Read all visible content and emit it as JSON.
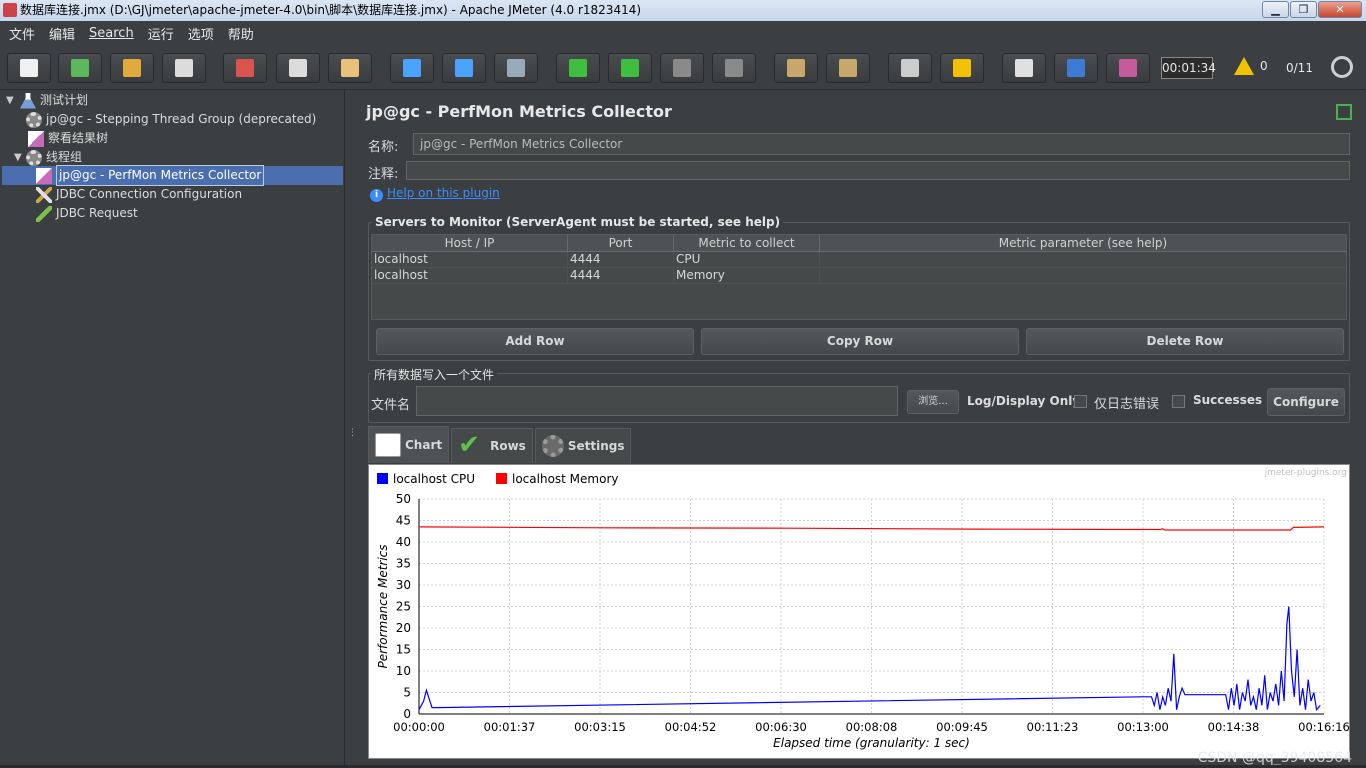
{
  "window": {
    "title": "数据库连接.jmx (D:\\GJ\\jmeter\\apache-jmeter-4.0\\bin\\脚本\\数据库连接.jmx) - Apache JMeter (4.0 r1823414)",
    "min": "▁",
    "max": "❐",
    "close": "✕"
  },
  "menu": [
    "文件",
    "编辑",
    "Search",
    "运行",
    "选项",
    "帮助"
  ],
  "toolbar": {
    "timer": "00:01:34",
    "warnings": "0",
    "threads": "0/11",
    "buttons": [
      {
        "name": "new-icon",
        "color": "#f0f0f0"
      },
      {
        "name": "templates-icon",
        "color": "#5cb85c"
      },
      {
        "name": "open-icon",
        "color": "#e2a93b"
      },
      {
        "name": "save-icon",
        "color": "#dcdcdc"
      },
      {
        "name": "cut-icon",
        "color": "#d9534f"
      },
      {
        "name": "copy-icon",
        "color": "#dcdcdc"
      },
      {
        "name": "paste-icon",
        "color": "#e8c27a"
      },
      {
        "name": "expand-icon",
        "color": "#4aa3ff"
      },
      {
        "name": "collapse-icon",
        "color": "#4aa3ff"
      },
      {
        "name": "toggle-icon",
        "color": "#9ab"
      },
      {
        "name": "start-icon",
        "color": "#3fbf3f"
      },
      {
        "name": "start-no-pause-icon",
        "color": "#3fbf3f"
      },
      {
        "name": "stop-icon",
        "color": "#8a8a8a"
      },
      {
        "name": "shutdown-icon",
        "color": "#8a8a8a"
      },
      {
        "name": "clear-icon",
        "color": "#c8a86a"
      },
      {
        "name": "clear-all-icon",
        "color": "#c8a86a"
      },
      {
        "name": "search-icon",
        "color": "#cccccc"
      },
      {
        "name": "reset-search-icon",
        "color": "#f2c200"
      },
      {
        "name": "function-helper-icon",
        "color": "#e0e0e0"
      },
      {
        "name": "help-icon",
        "color": "#3b7bd6"
      },
      {
        "name": "remote-icon",
        "color": "#c75a9b"
      }
    ]
  },
  "tree": [
    {
      "label": "测试计划",
      "icon": "flask-icon"
    },
    {
      "label": "jp@gc - Stepping Thread Group (deprecated)",
      "icon": "gear-icon"
    },
    {
      "label": "察看结果树",
      "icon": "chart-icon"
    },
    {
      "label": "线程组",
      "icon": "gear-icon"
    },
    {
      "label": "jp@gc - PerfMon Metrics Collector",
      "icon": "chart-icon"
    },
    {
      "label": "JDBC Connection Configuration",
      "icon": "wrench-icon"
    },
    {
      "label": "JDBC Request",
      "icon": "pen-icon"
    }
  ],
  "panel": {
    "title": "jp@gc - PerfMon Metrics Collector",
    "name_label": "名称:",
    "name_value": "jp@gc - PerfMon Metrics Collector",
    "comment_label": "注释:",
    "comment_value": "",
    "help_link": "Help on this plugin"
  },
  "servers": {
    "group_title": "Servers to Monitor (ServerAgent must be started, see help)",
    "columns": [
      "Host / IP",
      "Port",
      "Metric to collect",
      "Metric parameter (see help)"
    ],
    "rows": [
      [
        "localhost",
        "4444",
        "CPU",
        ""
      ],
      [
        "localhost",
        "4444",
        "Memory",
        ""
      ]
    ],
    "add_row": "Add Row",
    "copy_row": "Copy Row",
    "delete_row": "Delete Row"
  },
  "file": {
    "group_title": "所有数据写入一个文件",
    "filename_label": "文件名",
    "filename_value": "",
    "browse": "浏览...",
    "log_display_label": "Log/Display Only:",
    "errors_label": "仅日志错误",
    "successes_label": "Successes",
    "configure": "Configure"
  },
  "tabs": [
    {
      "label": "Chart",
      "icon": "chart-tab-icon",
      "active": true
    },
    {
      "label": "Rows",
      "icon": "check-icon",
      "active": false
    },
    {
      "label": "Settings",
      "icon": "gear-icon",
      "active": false
    }
  ],
  "chart_data": {
    "type": "line",
    "watermark": "jmeter-plugins.org",
    "xlabel": "Elapsed time (granularity: 1 sec)",
    "ylabel": "Performance Metrics",
    "ylim": [
      0,
      50
    ],
    "yticks": [
      "0",
      "5",
      "10",
      "15",
      "20",
      "25",
      "30",
      "35",
      "40",
      "45",
      "50"
    ],
    "xticks": [
      "00:00:00",
      "00:01:37",
      "00:03:15",
      "00:04:52",
      "00:06:30",
      "00:08:08",
      "00:09:45",
      "00:11:23",
      "00:13:00",
      "00:14:38",
      "00:16:16"
    ],
    "xlim_sec": [
      0,
      976
    ],
    "grid": true,
    "legend_position": "top-left",
    "series": [
      {
        "name": "localhost CPU",
        "color": "#0000ff",
        "points": [
          [
            0,
            1
          ],
          [
            5,
            3
          ],
          [
            8,
            5.5
          ],
          [
            11,
            3.5
          ],
          [
            14,
            1.5
          ],
          [
            20,
            1.5
          ],
          [
            780,
            4
          ],
          [
            790,
            4
          ],
          [
            793,
            2
          ],
          [
            796,
            5
          ],
          [
            799,
            1
          ],
          [
            802,
            4
          ],
          [
            805,
            2
          ],
          [
            808,
            6
          ],
          [
            811,
            3
          ],
          [
            814,
            14
          ],
          [
            817,
            1
          ],
          [
            820,
            4
          ],
          [
            823,
            6
          ],
          [
            826,
            4.5
          ],
          [
            870,
            4.5
          ],
          [
            873,
            1
          ],
          [
            876,
            6
          ],
          [
            879,
            2
          ],
          [
            882,
            7
          ],
          [
            885,
            1
          ],
          [
            888,
            5
          ],
          [
            891,
            3
          ],
          [
            894,
            8
          ],
          [
            897,
            2
          ],
          [
            900,
            4
          ],
          [
            903,
            1
          ],
          [
            906,
            6
          ],
          [
            909,
            2
          ],
          [
            912,
            9
          ],
          [
            915,
            1
          ],
          [
            918,
            5
          ],
          [
            921,
            3
          ],
          [
            924,
            7
          ],
          [
            927,
            2
          ],
          [
            930,
            10
          ],
          [
            933,
            3
          ],
          [
            936,
            21
          ],
          [
            938,
            25
          ],
          [
            941,
            10
          ],
          [
            944,
            4
          ],
          [
            947,
            15
          ],
          [
            950,
            2
          ],
          [
            953,
            6
          ],
          [
            956,
            1
          ],
          [
            959,
            8
          ],
          [
            962,
            3
          ],
          [
            965,
            5
          ],
          [
            968,
            1
          ],
          [
            972,
            2
          ]
        ]
      },
      {
        "name": "localhost Memory",
        "color": "#ff0000",
        "points": [
          [
            0,
            43.5
          ],
          [
            200,
            43.3
          ],
          [
            400,
            43.2
          ],
          [
            600,
            43
          ],
          [
            800,
            42.9
          ],
          [
            802,
            43.1
          ],
          [
            804,
            42.8
          ],
          [
            900,
            42.8
          ],
          [
            940,
            42.8
          ],
          [
            943,
            43.4
          ],
          [
            976,
            43.5
          ]
        ]
      }
    ]
  },
  "watermark": "CSDN @qq_39408564"
}
